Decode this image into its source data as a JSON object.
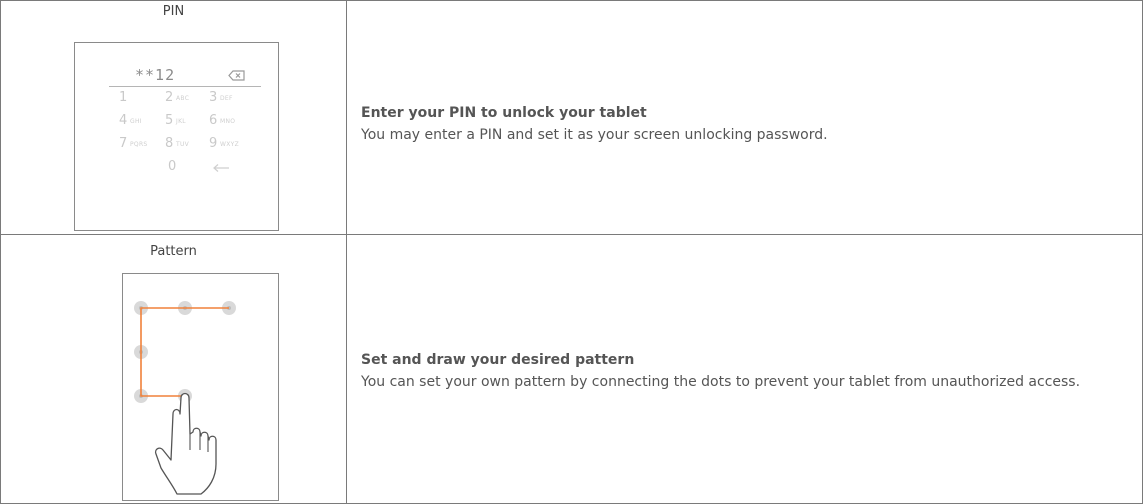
{
  "rows": [
    {
      "caption": "PIN",
      "title": "Enter your PIN to unlock your tablet",
      "description": "You may enter a PIN and set it as your screen unlocking password."
    },
    {
      "caption": "Pattern",
      "title": "Set and draw your desired pattern",
      "description": "You can set your own pattern by connecting the dots to prevent your tablet from unauthorized access."
    }
  ],
  "pin": {
    "entry": "**12",
    "keys": [
      {
        "num": "1",
        "letters": ""
      },
      {
        "num": "2",
        "letters": "ABC"
      },
      {
        "num": "3",
        "letters": "DEF"
      },
      {
        "num": "4",
        "letters": "GHI"
      },
      {
        "num": "5",
        "letters": "JKL"
      },
      {
        "num": "6",
        "letters": "MNO"
      },
      {
        "num": "7",
        "letters": "PQRS"
      },
      {
        "num": "8",
        "letters": "TUV"
      },
      {
        "num": "9",
        "letters": "WXYZ"
      },
      {
        "num": "0",
        "letters": ""
      }
    ]
  },
  "colors": {
    "pattern_line": "#f0813a",
    "dot": "#d9d9d9",
    "border": "#7a7a7a"
  }
}
